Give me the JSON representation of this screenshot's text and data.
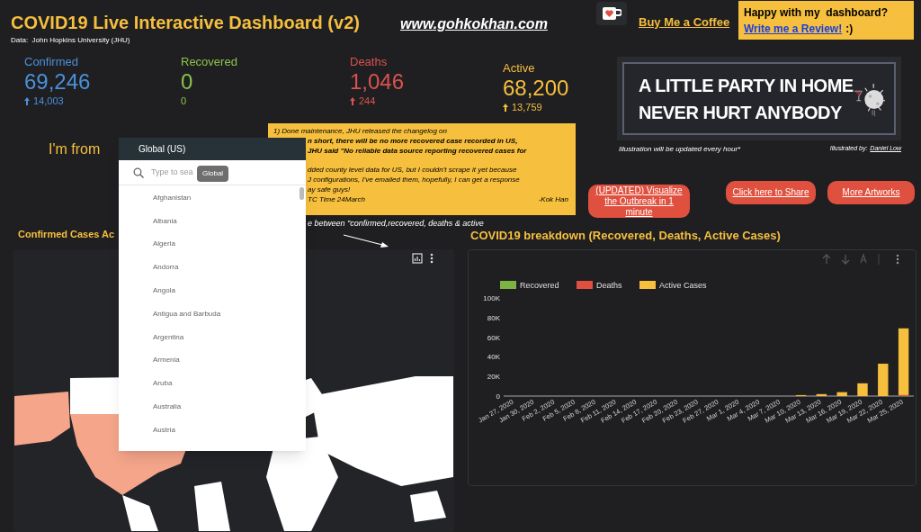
{
  "header": {
    "title": "COVID19 Live Interactive Dashboard (v2)",
    "website": "www.gohkokhan.com",
    "data_source": "Data:  John Hopkins University (JHU)"
  },
  "coffee_link": "Buy Me a Coffee",
  "review_box": {
    "text": "Happy with my  dashboard?",
    "link": "Write me a Review!",
    "suffix": ":)"
  },
  "kpis": [
    {
      "label": "Confirmed",
      "value": "69,246",
      "change": "14,003",
      "increase": true,
      "color": "#4a90d9"
    },
    {
      "label": "Recovered",
      "value": "0",
      "change": "0",
      "increase": false,
      "color": "#8bc34a"
    },
    {
      "label": "Deaths",
      "value": "1,046",
      "change": "244",
      "increase": true,
      "color": "#d9534f"
    },
    {
      "label": "Active",
      "value": "68,200",
      "change": "13,759",
      "increase": true,
      "color": "#f6bf3d"
    }
  ],
  "banner": {
    "lines": [
      "A LITTLE PARTY IN HOME",
      "NEVER HURT ANYBODY"
    ],
    "caption": "Illustration will be updated every hour*",
    "credit_label": "Illustrated by:",
    "credit_name": "Daniel Low"
  },
  "note": {
    "lines": [
      {
        "text": "1) Done maintenance, JHU released the changelog on",
        "bold": false
      },
      {
        "text": "n short, there will be no more recovered case recorded in US,",
        "bold": true
      },
      {
        "text": "JHU said \"No reliable data source reporting recovered cases for",
        "bold": true
      },
      {
        "text": "dded county level data for US, but I couldn't scrape it yet because",
        "bold": false
      },
      {
        "text": "J configurations, I've emailed them, hopefully, I can get a response",
        "bold": false
      },
      {
        "text": "ay safe guys!",
        "bold": false
      },
      {
        "text": "TC Time 24March",
        "bold": false
      }
    ],
    "signature": "-Kok Han"
  },
  "hint": "e between \"confirmed,recovered, deaths & active",
  "buttons": [
    "(UPDATED) Visualize the Outbreak in 1 minute",
    "Click here to Share",
    "More Artworks"
  ],
  "location": {
    "label": "I'm from",
    "selected": "Global (US)",
    "placeholder": "Type to sea",
    "tooltip": "Global",
    "options": [
      "Afghanistan",
      "Albania",
      "Algeria",
      "Andorra",
      "Angola",
      "Antigua and Barbuda",
      "Argentina",
      "Armenia",
      "Aruba",
      "Australia",
      "Austria"
    ]
  },
  "map_panel": {
    "title": "Confirmed Cases Ac"
  },
  "chart_panel": {
    "title": "COVID19 breakdown (Recovered, Deaths, Active Cases)",
    "chart_data": {
      "type": "bar",
      "stacked": true,
      "legend": "top",
      "ylim": [
        0,
        100000
      ],
      "yticks": [
        {
          "value": 0,
          "label": "0"
        },
        {
          "value": 20000,
          "label": "20K"
        },
        {
          "value": 40000,
          "label": "40K"
        },
        {
          "value": 60000,
          "label": "60K"
        },
        {
          "value": 80000,
          "label": "80K"
        },
        {
          "value": 100000,
          "label": "100K"
        }
      ],
      "categories": [
        "Jan 27, 2020",
        "Jan 30, 2020",
        "Feb 2, 2020",
        "Feb 5, 2020",
        "Feb 8, 2020",
        "Feb 11, 2020",
        "Feb 14, 2020",
        "Feb 17, 2020",
        "Feb 20, 2020",
        "Feb 23, 2020",
        "Feb 27, 2020",
        "Mar 1, 2020",
        "Mar 4, 2020",
        "Mar 7, 2020",
        "Mar 10, 2020",
        "Mar 13, 2020",
        "Mar 16, 2020",
        "Mar 19, 2020",
        "Mar 22, 2020",
        "Mar 25, 2020"
      ],
      "series": [
        {
          "name": "Recovered",
          "color": "#7cb342",
          "values": [
            0,
            0,
            0,
            0,
            0,
            0,
            0,
            0,
            0,
            0,
            0,
            0,
            0,
            0,
            0,
            0,
            0,
            0,
            0,
            0
          ]
        },
        {
          "name": "Deaths",
          "color": "#e0503f",
          "values": [
            0,
            0,
            0,
            0,
            0,
            0,
            0,
            0,
            0,
            0,
            0,
            0,
            0,
            0,
            0,
            0,
            0,
            0,
            0,
            1000
          ]
        },
        {
          "name": "Active Cases",
          "color": "#f6bf3d",
          "values": [
            0,
            0,
            0,
            0,
            0,
            0,
            0,
            0,
            0,
            0,
            0,
            0,
            0,
            0,
            1000,
            2000,
            4000,
            13000,
            33000,
            68000
          ]
        }
      ]
    }
  }
}
